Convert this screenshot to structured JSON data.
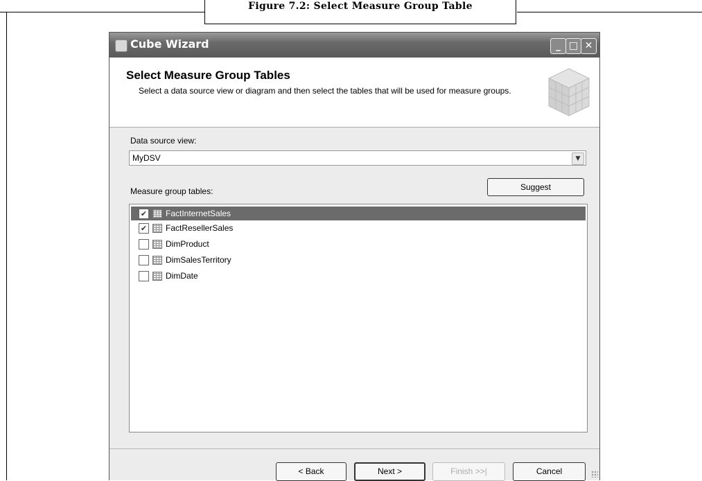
{
  "figure": {
    "caption": "Figure 7.2: Select Measure Group Table"
  },
  "window": {
    "title": "Cube Wizard",
    "controls": {
      "minimize": "_",
      "maximize": "□",
      "close": "✕"
    }
  },
  "header": {
    "title": "Select Measure Group Tables",
    "description": "Select a data source view or diagram and then select the tables that will be used for measure groups."
  },
  "data_source_view": {
    "label": "Data source view:",
    "value": "MyDSV"
  },
  "measure_group_tables": {
    "label": "Measure group tables:",
    "suggest_label": "Suggest",
    "items": [
      {
        "name": "FactInternetSales",
        "checked": true,
        "selected": true
      },
      {
        "name": "FactResellerSales",
        "checked": true,
        "selected": false
      },
      {
        "name": "DimProduct",
        "checked": false,
        "selected": false
      },
      {
        "name": "DimSalesTerritory",
        "checked": false,
        "selected": false
      },
      {
        "name": "DimDate",
        "checked": false,
        "selected": false
      }
    ]
  },
  "footer": {
    "back_label": "< Back",
    "next_label": "Next >",
    "finish_label": "Finish >>|",
    "cancel_label": "Cancel"
  }
}
